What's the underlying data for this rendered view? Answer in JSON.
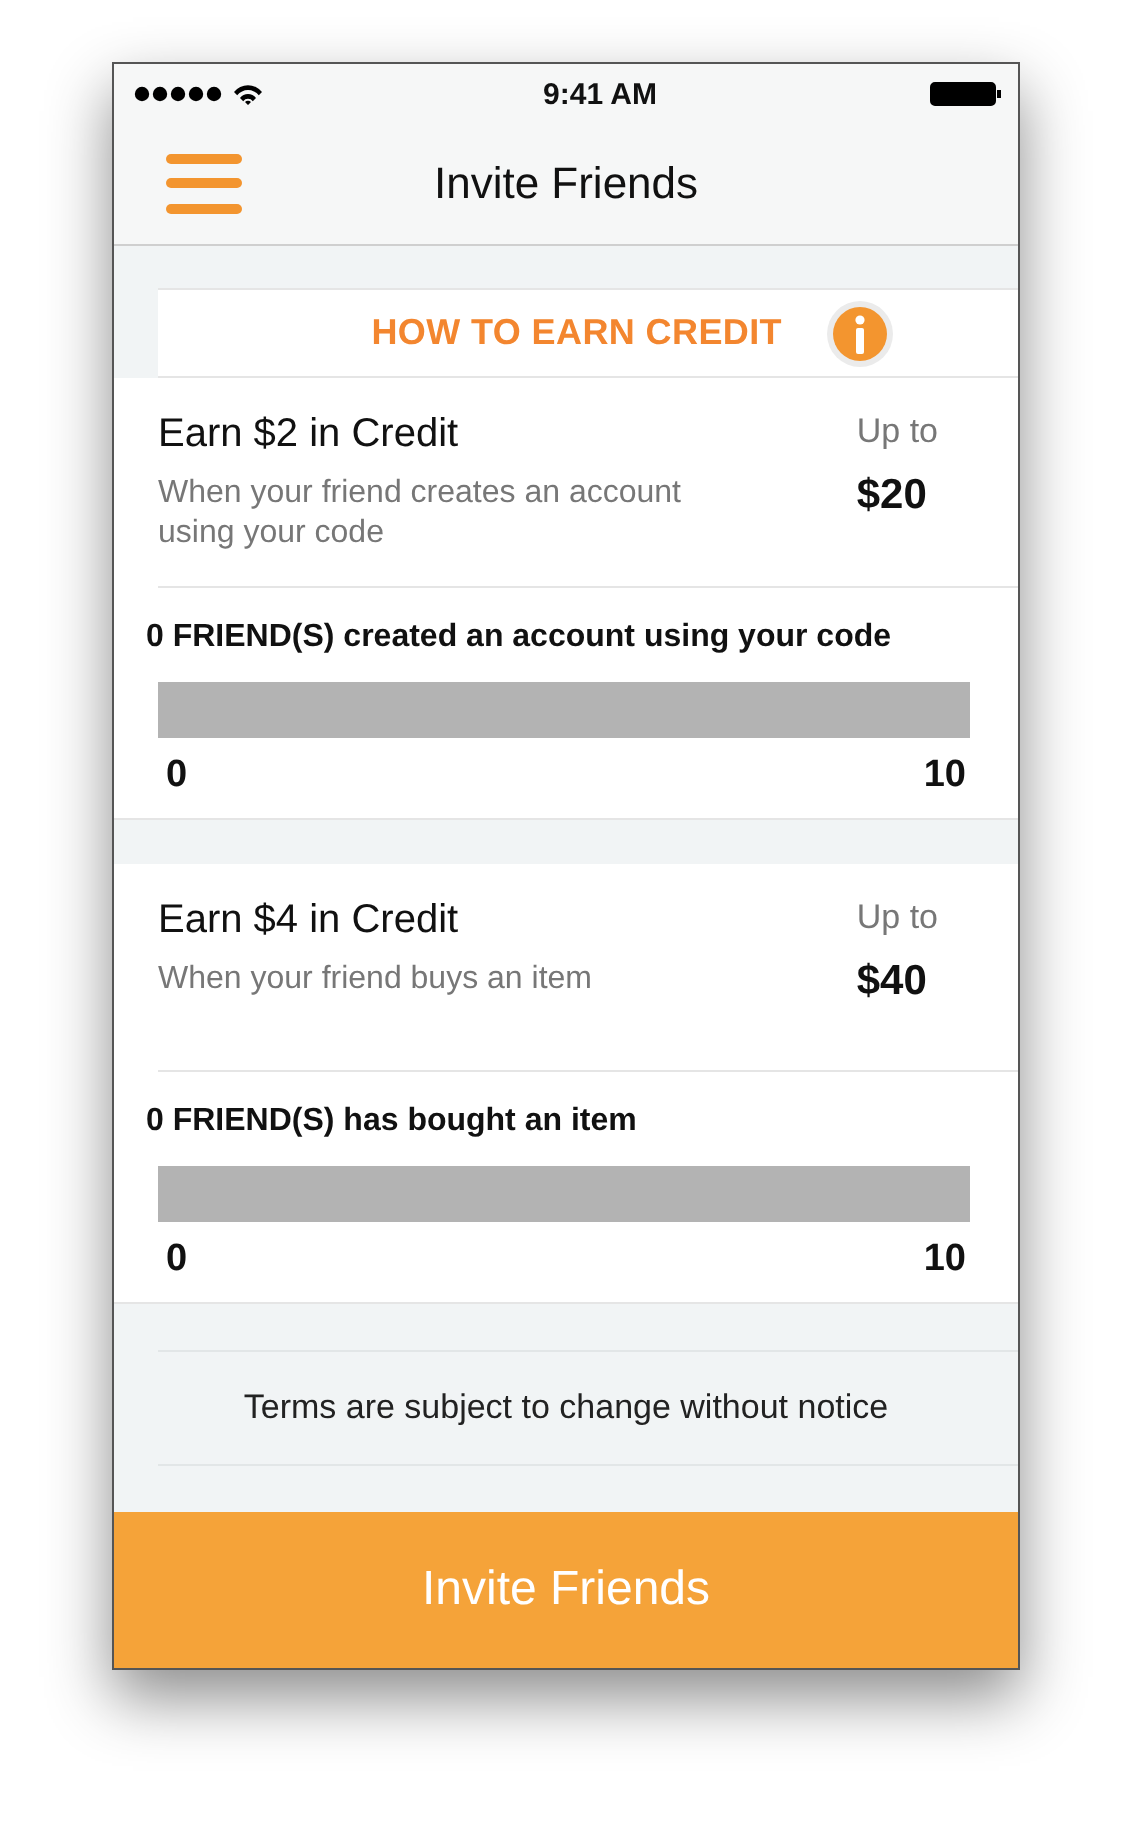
{
  "status_bar": {
    "time": "9:41 AM"
  },
  "nav": {
    "title": "Invite Friends"
  },
  "section_header": {
    "title": "HOW TO EARN CREDIT"
  },
  "offers": [
    {
      "title": "Earn $2 in Credit",
      "description": "When your friend creates an account using your code",
      "cap_label": "Up to",
      "cap_amount": "$20",
      "progress_label": "0 FRIEND(S) created an account using your code",
      "level": 0,
      "min": "0",
      "max": "10"
    },
    {
      "title": "Earn $4 in Credit",
      "description": "When your friend buys an item",
      "cap_label": "Up to",
      "cap_amount": "$40",
      "progress_label": "0 FRIEND(S) has bought an item",
      "level": 0,
      "min": "0",
      "max": "10"
    }
  ],
  "terms": "Terms are subject to change without notice",
  "invite_button": "Invite Friends"
}
